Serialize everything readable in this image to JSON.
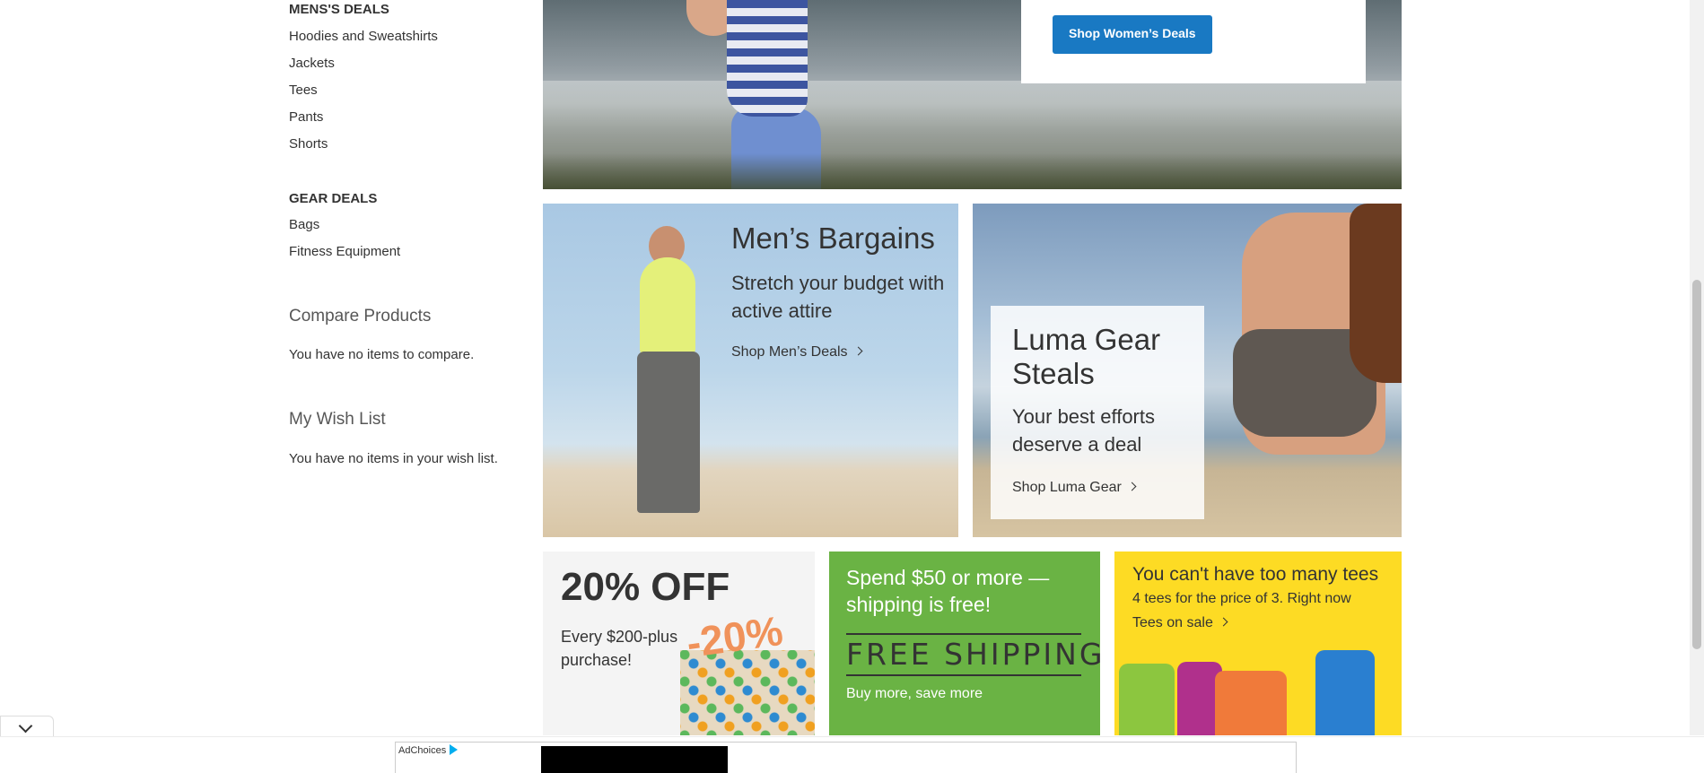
{
  "sidebar": {
    "mens_heading": "MENS'S DEALS",
    "mens_links": [
      "Hoodies and Sweatshirts",
      "Jackets",
      "Tees",
      "Pants",
      "Shorts"
    ],
    "gear_heading": "GEAR DEALS",
    "gear_links": [
      "Bags",
      "Fitness Equipment"
    ],
    "compare": {
      "title": "Compare Products",
      "empty": "You have no items to compare."
    },
    "wishlist": {
      "title": "My Wish List",
      "empty": "You have no items in your wish list."
    }
  },
  "hero": {
    "button": "Shop Women’s Deals"
  },
  "mens_tile": {
    "title": "Men’s Bargains",
    "subtitle": "Stretch your budget with active attire",
    "link": "Shop Men’s Deals"
  },
  "gear_tile": {
    "title": "Luma Gear Steals",
    "subtitle": "Your best efforts deserve a deal",
    "link": "Shop Luma Gear"
  },
  "discount_tile": {
    "headline": "20% OFF",
    "subtitle": "Every $200-plus purchase!",
    "badge": "-20%"
  },
  "shipping_tile": {
    "title": "Spend $50 or more — shipping is free!",
    "banner": "FREE SHIPPING",
    "subtitle": "Buy more, save more"
  },
  "tees_tile": {
    "title": "You can't have too many tees",
    "subtitle": "4 tees for the price of 3. Right now",
    "link": "Tees on sale"
  },
  "tee_colors": [
    "#8cc63f",
    "#b0308c",
    "#f07a3a",
    "#2a7fd0"
  ],
  "ad": {
    "adchoices": "AdChoices"
  }
}
